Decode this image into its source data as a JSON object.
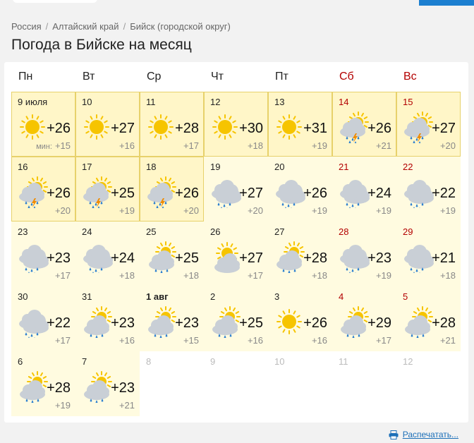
{
  "breadcrumb": [
    "Россия",
    "Алтайский край",
    "Бийск (городской округ)"
  ],
  "title": "Погода в Бийске на месяц",
  "weekdays": [
    {
      "label": "Пн",
      "weekend": false
    },
    {
      "label": "Вт",
      "weekend": false
    },
    {
      "label": "Ср",
      "weekend": false
    },
    {
      "label": "Чт",
      "weekend": false
    },
    {
      "label": "Пт",
      "weekend": false
    },
    {
      "label": "Сб",
      "weekend": true
    },
    {
      "label": "Вс",
      "weekend": true
    }
  ],
  "min_label": "мин:",
  "days": [
    {
      "date": "9 июля",
      "icon": "sun",
      "max": "+26",
      "min": "+15",
      "weekend": false,
      "state": "current"
    },
    {
      "date": "10",
      "icon": "sun",
      "max": "+27",
      "min": "+16",
      "weekend": false,
      "state": "current"
    },
    {
      "date": "11",
      "icon": "sun",
      "max": "+28",
      "min": "+17",
      "weekend": false,
      "state": "current"
    },
    {
      "date": "12",
      "icon": "sun",
      "max": "+30",
      "min": "+18",
      "weekend": false,
      "state": "current"
    },
    {
      "date": "13",
      "icon": "sun",
      "max": "+31",
      "min": "+19",
      "weekend": false,
      "state": "current"
    },
    {
      "date": "14",
      "icon": "storm",
      "max": "+26",
      "min": "+21",
      "weekend": true,
      "state": "current"
    },
    {
      "date": "15",
      "icon": "storm",
      "max": "+27",
      "min": "+20",
      "weekend": true,
      "state": "current"
    },
    {
      "date": "16",
      "icon": "storm",
      "max": "+26",
      "min": "+20",
      "weekend": false,
      "state": "current"
    },
    {
      "date": "17",
      "icon": "storm",
      "max": "+25",
      "min": "+19",
      "weekend": false,
      "state": "current"
    },
    {
      "date": "18",
      "icon": "storm",
      "max": "+26",
      "min": "+20",
      "weekend": false,
      "state": "current"
    },
    {
      "date": "19",
      "icon": "rain",
      "max": "+27",
      "min": "+20",
      "weekend": false,
      "state": "normal"
    },
    {
      "date": "20",
      "icon": "rain",
      "max": "+26",
      "min": "+19",
      "weekend": false,
      "state": "normal"
    },
    {
      "date": "21",
      "icon": "rain",
      "max": "+24",
      "min": "+19",
      "weekend": true,
      "state": "normal"
    },
    {
      "date": "22",
      "icon": "rain",
      "max": "+22",
      "min": "+19",
      "weekend": true,
      "state": "normal"
    },
    {
      "date": "23",
      "icon": "rain",
      "max": "+23",
      "min": "+17",
      "weekend": false,
      "state": "normal"
    },
    {
      "date": "24",
      "icon": "rain",
      "max": "+24",
      "min": "+18",
      "weekend": false,
      "state": "normal"
    },
    {
      "date": "25",
      "icon": "sun-cloud",
      "max": "+25",
      "min": "+18",
      "weekend": false,
      "state": "normal"
    },
    {
      "date": "26",
      "icon": "sun-cloud-dry",
      "max": "+27",
      "min": "+17",
      "weekend": false,
      "state": "normal"
    },
    {
      "date": "27",
      "icon": "sun-rain",
      "max": "+28",
      "min": "+18",
      "weekend": false,
      "state": "normal"
    },
    {
      "date": "28",
      "icon": "rain",
      "max": "+23",
      "min": "+19",
      "weekend": true,
      "state": "normal"
    },
    {
      "date": "29",
      "icon": "rain",
      "max": "+21",
      "min": "+18",
      "weekend": true,
      "state": "normal"
    },
    {
      "date": "30",
      "icon": "rain",
      "max": "+22",
      "min": "+17",
      "weekend": false,
      "state": "normal"
    },
    {
      "date": "31",
      "icon": "sun-rain",
      "max": "+23",
      "min": "+16",
      "weekend": false,
      "state": "normal"
    },
    {
      "date": "1 авг",
      "icon": "sun-rain",
      "max": "+23",
      "min": "+15",
      "weekend": false,
      "state": "normal",
      "bold": true
    },
    {
      "date": "2",
      "icon": "sun-rain",
      "max": "+25",
      "min": "+16",
      "weekend": false,
      "state": "normal"
    },
    {
      "date": "3",
      "icon": "sun",
      "max": "+26",
      "min": "+16",
      "weekend": false,
      "state": "normal"
    },
    {
      "date": "4",
      "icon": "sun-rain",
      "max": "+29",
      "min": "+17",
      "weekend": true,
      "state": "normal"
    },
    {
      "date": "5",
      "icon": "sun-rain",
      "max": "+28",
      "min": "+21",
      "weekend": true,
      "state": "normal"
    },
    {
      "date": "6",
      "icon": "sun-rain",
      "max": "+28",
      "min": "+19",
      "weekend": false,
      "state": "normal"
    },
    {
      "date": "7",
      "icon": "sun-rain",
      "max": "+23",
      "min": "+21",
      "weekend": false,
      "state": "normal"
    },
    {
      "date": "8",
      "icon": "",
      "max": "",
      "min": "",
      "weekend": false,
      "state": "empty"
    },
    {
      "date": "9",
      "icon": "",
      "max": "",
      "min": "",
      "weekend": false,
      "state": "empty"
    },
    {
      "date": "10",
      "icon": "",
      "max": "",
      "min": "",
      "weekend": false,
      "state": "empty"
    },
    {
      "date": "11",
      "icon": "",
      "max": "",
      "min": "",
      "weekend": true,
      "state": "empty"
    },
    {
      "date": "12",
      "icon": "",
      "max": "",
      "min": "",
      "weekend": true,
      "state": "empty"
    }
  ],
  "print_label": "Распечатать...",
  "colors": {
    "sun": "#f6c400",
    "cloud": "#c9cfd6",
    "rain": "#2b7fd0",
    "lightning": "#f08c00",
    "weekend": "#b30000",
    "link": "#1c6fb8"
  }
}
